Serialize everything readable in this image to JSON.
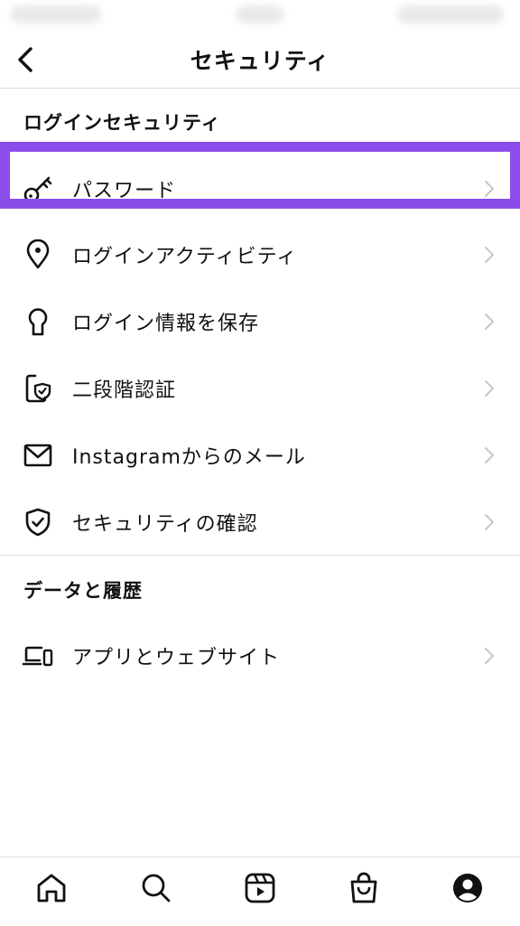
{
  "header": {
    "title": "セキュリティ",
    "back_icon": "chevron-left-icon"
  },
  "sections": {
    "login_security": {
      "title": "ログインセキュリティ"
    },
    "data_history": {
      "title": "データと履歴"
    }
  },
  "items": [
    {
      "label": "パスワード",
      "icon": "key-icon"
    },
    {
      "label": "ログインアクティビティ",
      "icon": "location-pin-icon"
    },
    {
      "label": "ログイン情報を保存",
      "icon": "keyhole-icon"
    },
    {
      "label": "二段階認証",
      "icon": "phone-shield-icon"
    },
    {
      "label": "Instagramからのメール",
      "icon": "mail-icon"
    },
    {
      "label": "セキュリティの確認",
      "icon": "shield-check-icon"
    },
    {
      "label": "アプリとウェブサイト",
      "icon": "devices-icon"
    }
  ],
  "colors": {
    "highlight": "#8b4dea",
    "chevron": "#c7c7c7",
    "text": "#111111"
  },
  "tabbar": [
    "home-icon",
    "search-icon",
    "reels-icon",
    "shop-icon",
    "profile-icon"
  ]
}
